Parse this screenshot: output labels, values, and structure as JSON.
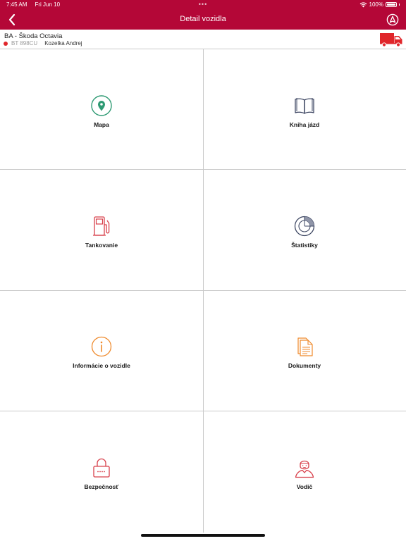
{
  "status_bar": {
    "time": "7:45 AM",
    "date": "Fri Jun 10",
    "dots": "•••",
    "battery": "100%"
  },
  "nav": {
    "title": "Detail vozidla",
    "back_icon": "chevron-left-icon",
    "action_icon": "navigation-arrow-icon"
  },
  "vehicle": {
    "name": "BA - Škoda Octavia",
    "plate": "BT 898CU",
    "driver": "Kozelka Andrej",
    "status_color": "#e0262b",
    "truck_color": "#e0262b"
  },
  "colors": {
    "brand": "#b40737",
    "divider": "#c9c9c9",
    "green": "#2e9a73",
    "red": "#d8404b",
    "orange": "#ef8a2c",
    "navy": "#3e4763"
  },
  "tiles": [
    {
      "label": "Mapa",
      "icon": "map-pin-icon"
    },
    {
      "label": "Kniha jázd",
      "icon": "book-icon"
    },
    {
      "label": "Tankovanie",
      "icon": "fuel-pump-icon"
    },
    {
      "label": "Štatistiky",
      "icon": "pie-chart-icon"
    },
    {
      "label": "Informácie o vozidle",
      "icon": "info-icon"
    },
    {
      "label": "Dokumenty",
      "icon": "documents-icon"
    },
    {
      "label": "Bezpečnosť",
      "icon": "lock-icon"
    },
    {
      "label": "Vodič",
      "icon": "driver-icon"
    }
  ]
}
